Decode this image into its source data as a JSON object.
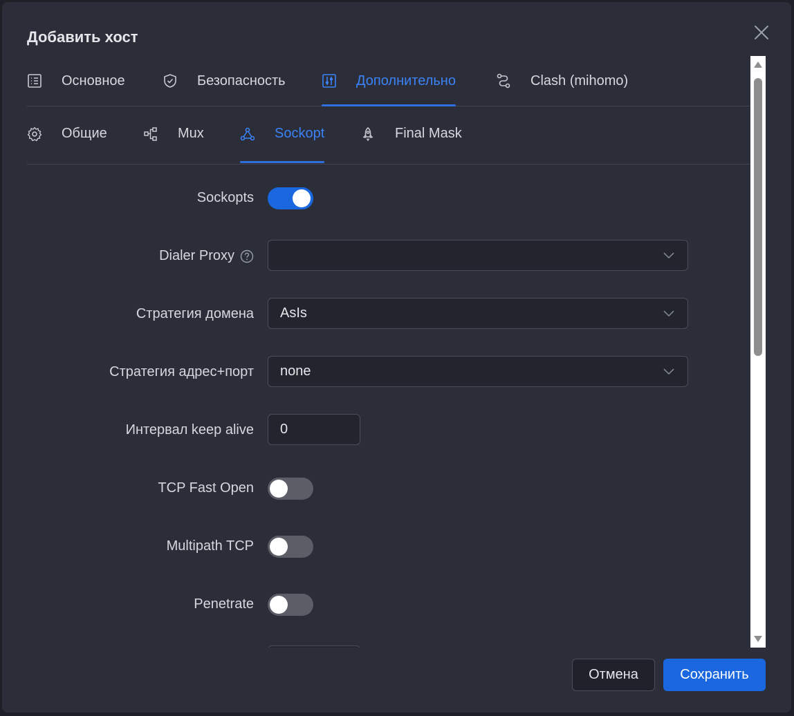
{
  "dialog": {
    "title": "Добавить хост",
    "close_icon": "close-icon"
  },
  "tabs": [
    {
      "label": "Основное",
      "icon": "list-icon",
      "active": false
    },
    {
      "label": "Безопасность",
      "icon": "shield-check-icon",
      "active": false
    },
    {
      "label": "Дополнительно",
      "icon": "sliders-icon",
      "active": true
    },
    {
      "label": "Clash (mihomo)",
      "icon": "route-icon",
      "active": false
    }
  ],
  "subtabs": [
    {
      "label": "Общие",
      "icon": "gear-icon",
      "active": false
    },
    {
      "label": "Mux",
      "icon": "network-icon",
      "active": false
    },
    {
      "label": "Sockopt",
      "icon": "nodes-icon",
      "active": true
    },
    {
      "label": "Final Mask",
      "icon": "rocket-icon",
      "active": false
    }
  ],
  "form": {
    "sockopts": {
      "label": "Sockopts",
      "on": true
    },
    "dialer_proxy": {
      "label": "Dialer Proxy",
      "value": "",
      "help_icon": "question-circle-icon"
    },
    "domain_strategy": {
      "label": "Стратегия домена",
      "value": "AsIs"
    },
    "addr_port_strategy": {
      "label": "Стратегия адрес+порт",
      "value": "none"
    },
    "keep_alive": {
      "label": "Интервал keep alive",
      "value": "0"
    },
    "tcp_fast_open": {
      "label": "TCP Fast Open",
      "on": false
    },
    "multipath_tcp": {
      "label": "Multipath TCP",
      "on": false
    },
    "penetrate": {
      "label": "Penetrate",
      "on": false
    }
  },
  "footer": {
    "cancel_label": "Отмена",
    "save_label": "Сохранить"
  },
  "colors": {
    "accent": "#1a67e0",
    "modal_bg": "#2b2e38",
    "active_tab": "#3b82f6"
  }
}
